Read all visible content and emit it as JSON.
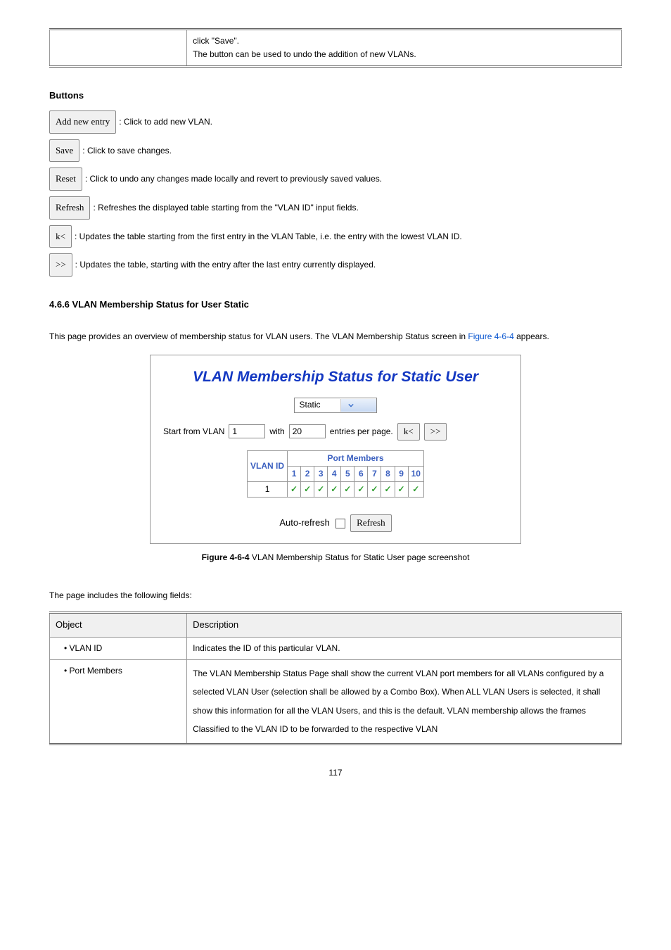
{
  "top_table": {
    "left": "",
    "right_line1": "click \"Save\".",
    "right_line2": "The button can be used to undo the addition of new VLANs."
  },
  "buttons_section_title": "Buttons",
  "buttons": [
    {
      "label": "Add new entry",
      "desc": ": Click to add new VLAN."
    },
    {
      "label": "Save",
      "desc": ": Click to save changes."
    },
    {
      "label": "Reset",
      "desc": ": Click to undo any changes made locally and revert to previously saved values."
    },
    {
      "label": "Refresh",
      "desc": ": Refreshes the displayed table starting from the \"VLAN ID\" input fields."
    },
    {
      "label": "k<",
      "desc": ": Updates the table starting from the first entry in the VLAN Table, i.e. the entry with the lowest VLAN ID."
    },
    {
      "label": ">>",
      "desc": ": Updates the table, starting with the entry after the last entry currently displayed."
    }
  ],
  "subsection_title": "4.6.6 VLAN Membership Status for User Static",
  "intro_para_1": "This page provides an overview of membership status for VLAN users. The VLAN Membership Status screen in ",
  "intro_link": "Figure 4-6-4",
  "intro_para_2": " appears.",
  "figure": {
    "title": "VLAN Membership Status for Static User",
    "dropdown_value": "Static",
    "start_label": "Start from VLAN",
    "start_value": "1",
    "with_label": "with",
    "with_value": "20",
    "entries_label": "entries per page.",
    "btn_first": "k<",
    "btn_next": ">>",
    "pm_header": "Port Members",
    "vlanid_header": "VLAN ID",
    "ports": [
      "1",
      "2",
      "3",
      "4",
      "5",
      "6",
      "7",
      "8",
      "9",
      "10"
    ],
    "row_vlan": "1",
    "auto_label": "Auto-refresh",
    "refresh_btn": "Refresh"
  },
  "figure_label": "Figure 4-6-4",
  "figure_caption": " VLAN Membership Status for Static User page screenshot",
  "fields_intro": "The page includes the following fields:",
  "fields_table": {
    "h1": "Object",
    "h2": "Description",
    "r1_obj": "VLAN ID",
    "r1_desc": "Indicates the ID of this particular VLAN.",
    "r2_obj": "Port Members",
    "r2_desc": "The VLAN Membership Status Page shall show the current VLAN port members for all VLANs configured by a selected VLAN User (selection shall be allowed by a Combo Box). When ALL VLAN Users is selected, it shall show this information for all the VLAN Users, and this is the default. VLAN membership allows the frames Classified to the VLAN ID to be forwarded to the respective VLAN"
  },
  "page_number": "117"
}
